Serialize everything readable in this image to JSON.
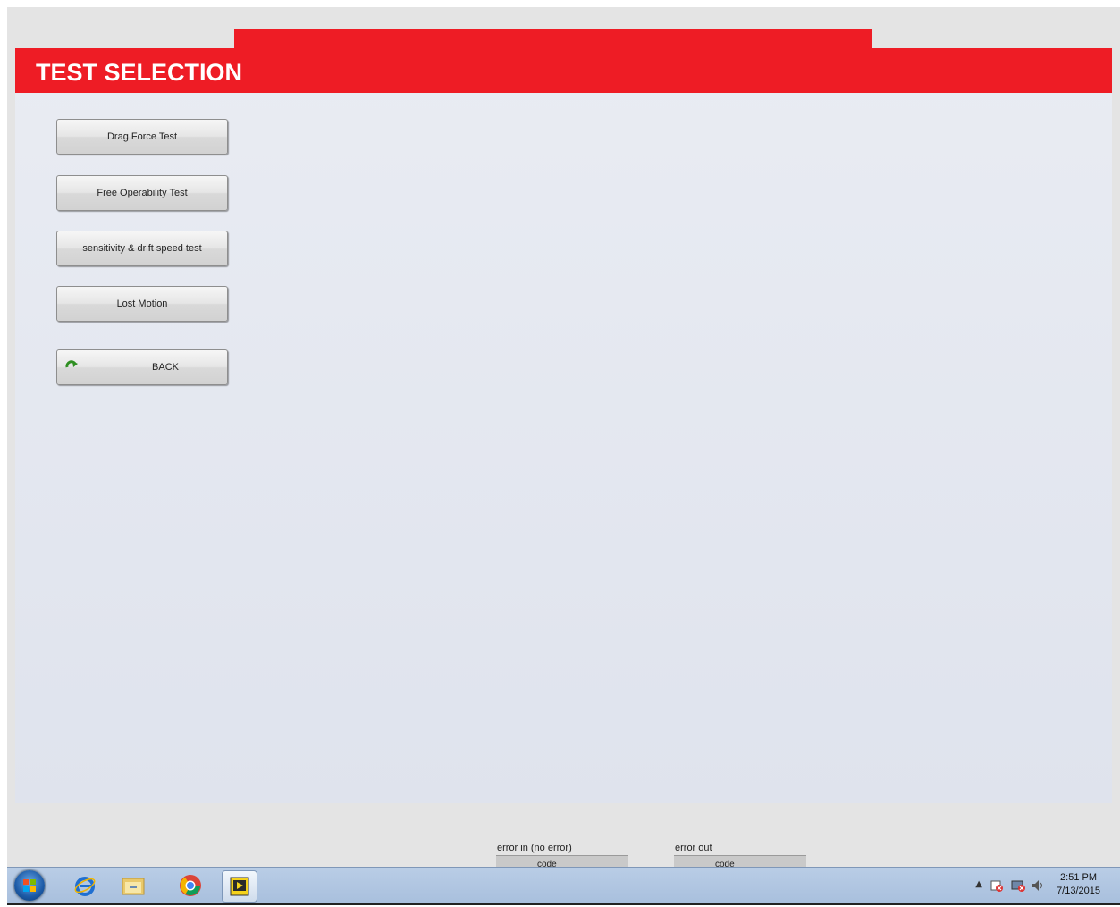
{
  "header": {
    "title": "TEST SELECTION"
  },
  "buttons": [
    {
      "label": "Drag Force Test"
    },
    {
      "label": "Free Operability Test"
    },
    {
      "label": "sensitivity & drift speed test"
    },
    {
      "label": "Lost Motion"
    },
    {
      "label": "BACK",
      "icon": "green-arrow-icon"
    }
  ],
  "error_in": {
    "label": "error in (no error)",
    "field_text": "code"
  },
  "error_out": {
    "label": "error out",
    "field_text": "code"
  },
  "taskbar": {
    "apps": [
      "internet-explorer-icon",
      "file-explorer-icon",
      "chrome-icon",
      "labview-icon"
    ],
    "time": "2:51 PM",
    "date": "7/13/2015"
  },
  "colors": {
    "accent": "#ee1c25",
    "panel_bg": "#e4e8f0"
  }
}
